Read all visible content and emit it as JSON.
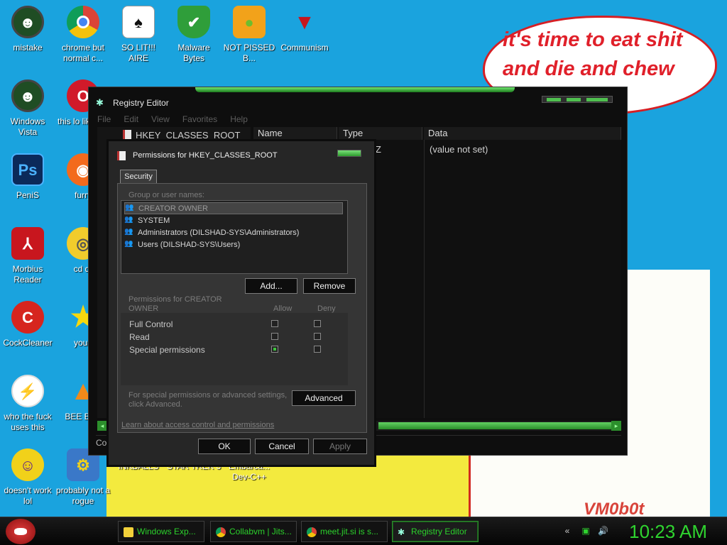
{
  "desktop": {
    "speech_text": "it's time to eat shit and die and chew",
    "watermark": "VM0b0t",
    "icons": [
      {
        "label": "mistake"
      },
      {
        "label": "chrome but normal c..."
      },
      {
        "label": "SO LIT!!! AIRE"
      },
      {
        "label": "Malware Bytes"
      },
      {
        "label": "NOT PISSED B..."
      },
      {
        "label": "Communism"
      },
      {
        "label": "Windows Vista"
      },
      {
        "label": "this lo like a v"
      },
      {
        "label": "PeniS"
      },
      {
        "label": "furry"
      },
      {
        "label": "Morbius Reader"
      },
      {
        "label": "cd dr"
      },
      {
        "label": "CockCleaner"
      },
      {
        "label": "you t"
      },
      {
        "label": "who the fuck uses this"
      },
      {
        "label": "BEE BEE"
      },
      {
        "label": "doesn't work lol"
      },
      {
        "label": "probably not a rogue"
      },
      {
        "label": "INKBALLS"
      },
      {
        "label": "STAR TREK 3"
      },
      {
        "label": "Embarca... Dev-C++"
      }
    ]
  },
  "regedit": {
    "title": "Registry Editor",
    "menu": [
      "File",
      "Edit",
      "View",
      "Favorites",
      "Help"
    ],
    "tree_root": "HKEY_CLASSES_ROOT",
    "columns": [
      "Name",
      "Type",
      "Data"
    ],
    "row_type_partial": "Z",
    "row_data": "(value not set)",
    "status": "Com"
  },
  "permissions": {
    "title": "Permissions for HKEY_CLASSES_ROOT",
    "tab": "Security",
    "group_label": "Group or user names:",
    "users": [
      "CREATOR OWNER",
      "SYSTEM",
      "Administrators (DILSHAD-SYS\\Administrators)",
      "Users (DILSHAD-SYS\\Users)"
    ],
    "add_label": "Add...",
    "remove_label": "Remove",
    "perm_label_line1": "Permissions for CREATOR",
    "perm_label_line2": "OWNER",
    "allow_label": "Allow",
    "deny_label": "Deny",
    "rows": [
      {
        "name": "Full Control",
        "allow": false,
        "deny": false
      },
      {
        "name": "Read",
        "allow": false,
        "deny": false
      },
      {
        "name": "Special permissions",
        "allow": true,
        "deny": false
      }
    ],
    "advanced_hint_line1": "For special permissions or advanced settings,",
    "advanced_hint_line2": "click Advanced.",
    "advanced_label": "Advanced",
    "link": "Learn about access control and permissions",
    "ok_label": "OK",
    "cancel_label": "Cancel",
    "apply_label": "Apply"
  },
  "taskbar": {
    "tasks": [
      {
        "label": "Windows Exp..."
      },
      {
        "label": "Collabvm | Jits..."
      },
      {
        "label": "meet.jit.si is s..."
      },
      {
        "label": "Registry Editor"
      }
    ],
    "clock": "10:23 AM"
  }
}
